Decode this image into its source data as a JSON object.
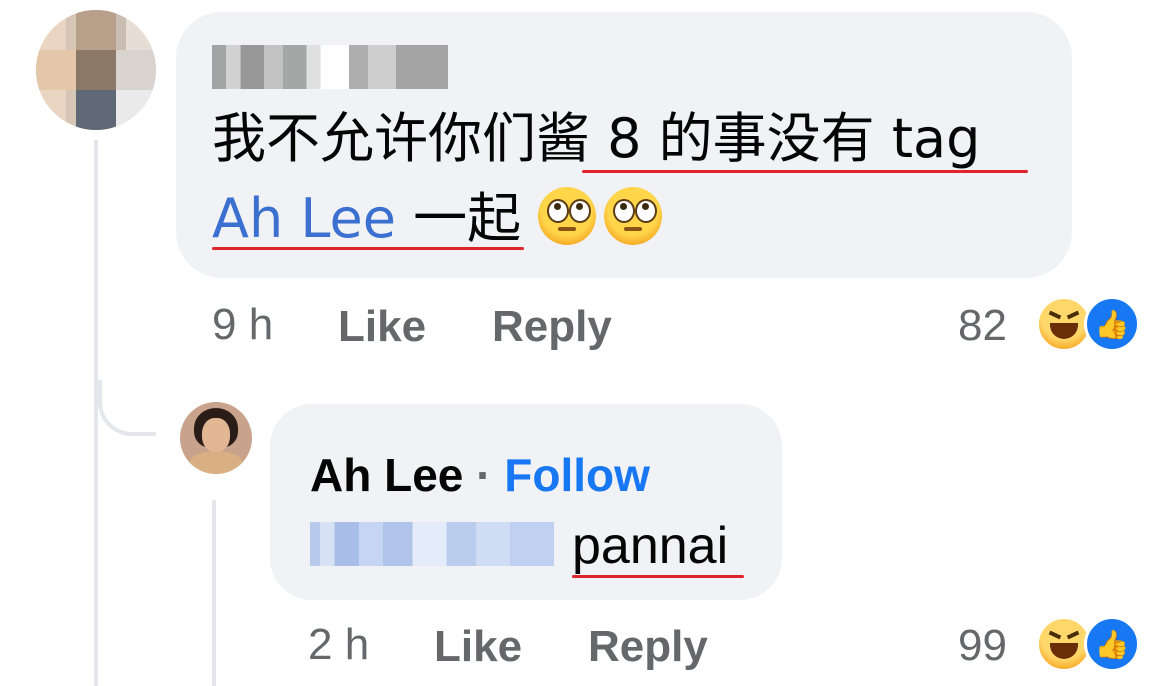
{
  "comment": {
    "author_name": "",
    "text_line1": "我不允许你们酱 8 的事没有 tag",
    "mention": "Ah Lee",
    "text_after_mention": " 一起",
    "emojis": [
      "face-with-rolling-eyes",
      "face-with-rolling-eyes"
    ],
    "time": "9 h",
    "like_label": "Like",
    "reply_label": "Reply",
    "reaction_count": "82",
    "reactions": [
      "haha-reaction-icon",
      "like-reaction-icon"
    ]
  },
  "reply": {
    "author_name": "Ah Lee",
    "separator": "·",
    "follow_label": "Follow",
    "text": "pannai",
    "time": "2 h",
    "like_label": "Like",
    "reply_label": "Reply",
    "reaction_count": "99",
    "reactions": [
      "haha-reaction-icon",
      "like-reaction-icon"
    ]
  },
  "colors": {
    "bubble": "#f0f2f5",
    "mention": "#3b6fd0",
    "follow": "#1877f2",
    "underline": "#e0242b",
    "meta": "#65676b"
  }
}
